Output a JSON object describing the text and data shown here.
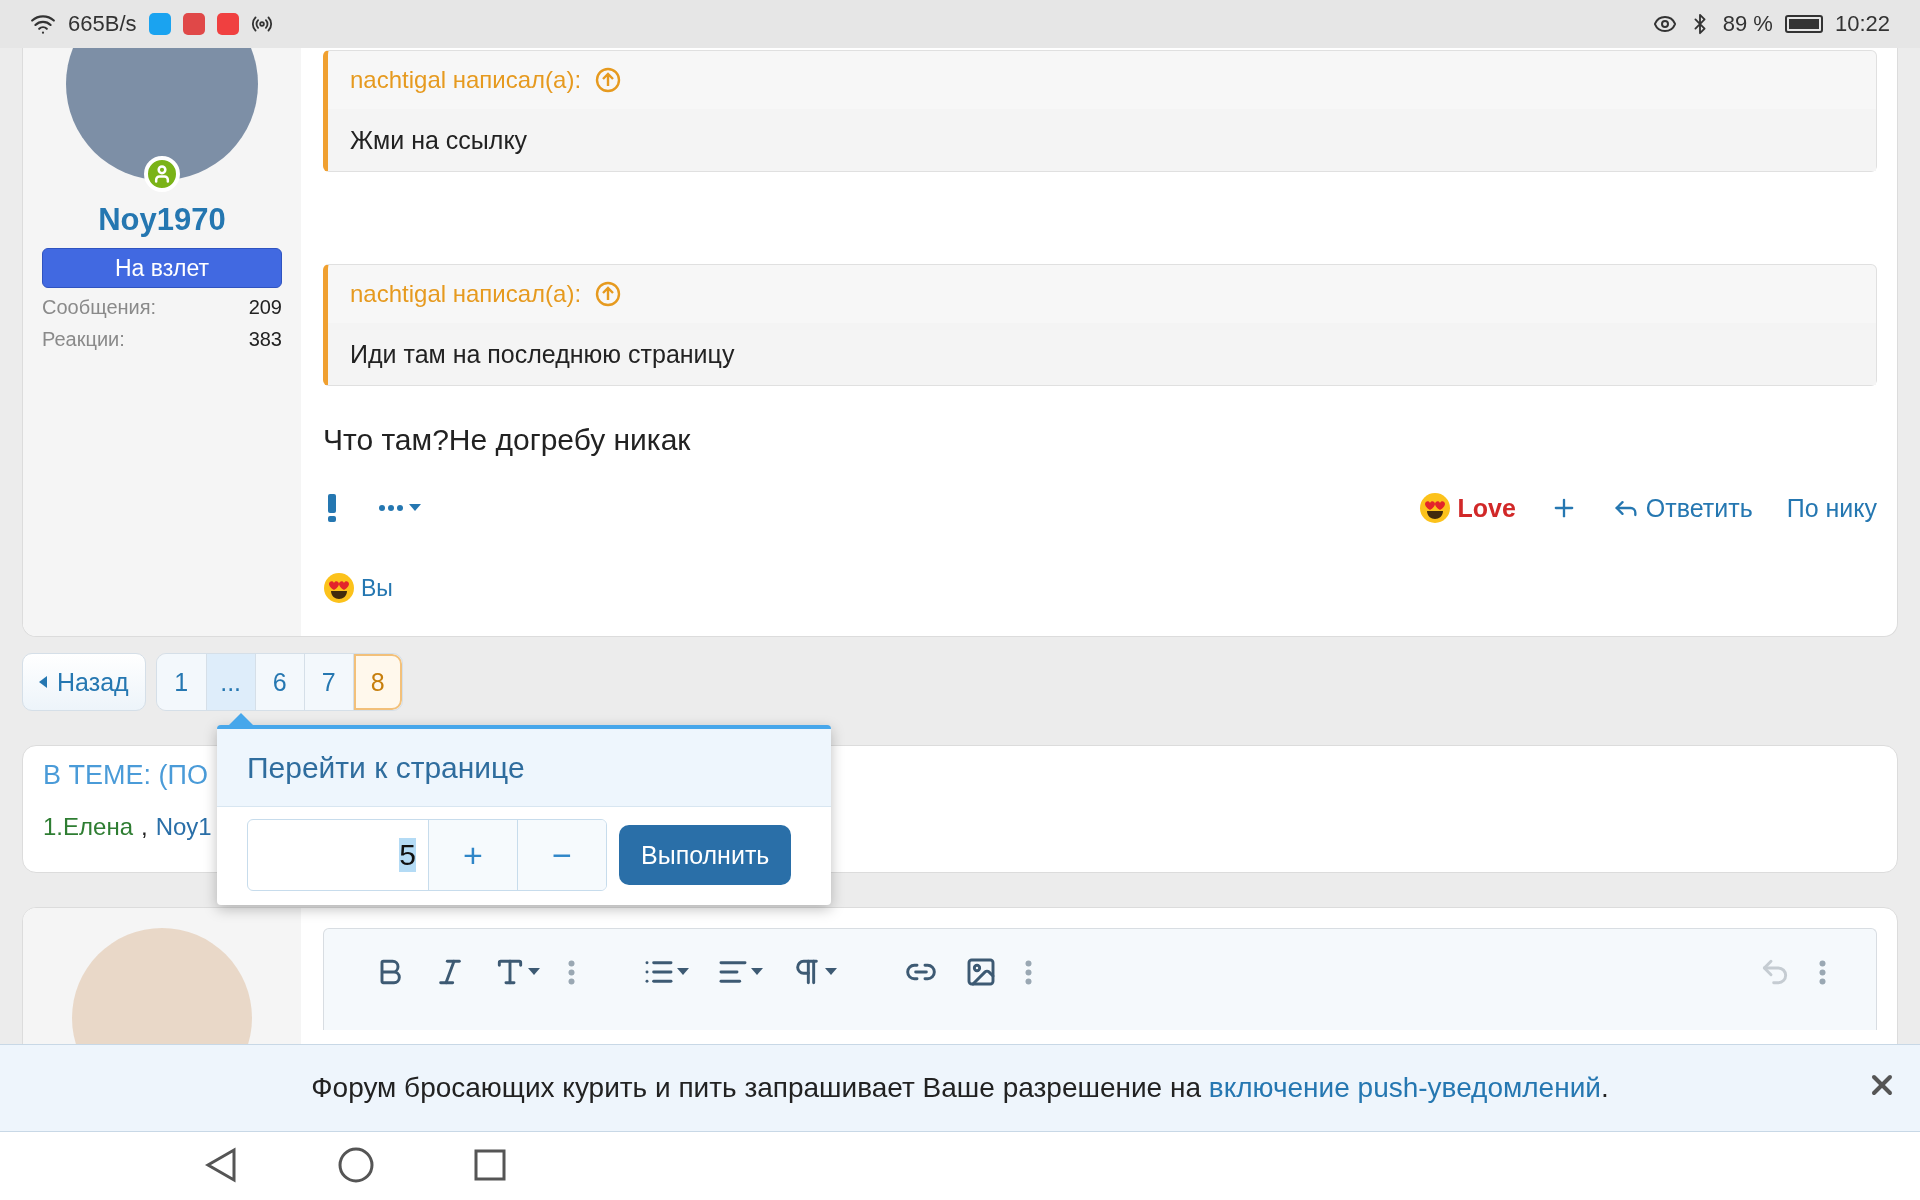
{
  "status_bar": {
    "network_speed": "665B/s",
    "battery": "89 %",
    "time": "10:22"
  },
  "post": {
    "author": {
      "name": "Noy1970",
      "title": "На взлет",
      "online": true,
      "stats": [
        {
          "label": "Сообщения:",
          "value": "209"
        },
        {
          "label": "Реакции:",
          "value": "383"
        }
      ]
    },
    "quotes": [
      {
        "attribution": "nachtigal написал(а):",
        "text": "Жми на ссылку"
      },
      {
        "attribution": "nachtigal написал(а):",
        "text": "Иди там на последнюю страницу"
      }
    ],
    "message": "Что там?Не догребу никак",
    "actions": {
      "reaction": "Love",
      "reply": "Ответить",
      "by_nick": "По нику"
    },
    "reactions_summary": "Вы"
  },
  "pagination": {
    "back": "Назад",
    "pages": [
      {
        "label": "1",
        "selected": false,
        "expanded": false
      },
      {
        "label": "...",
        "selected": false,
        "expanded": true
      },
      {
        "label": "6",
        "selected": false,
        "expanded": false
      },
      {
        "label": "7",
        "selected": false,
        "expanded": false
      },
      {
        "label": "8",
        "selected": true,
        "expanded": false
      }
    ]
  },
  "page_jump": {
    "title": "Перейти к странице",
    "value": "5",
    "increment": "+",
    "decrement": "−",
    "submit": "Выполнить"
  },
  "topic": {
    "heading": "В ТЕМЕ: (ПО",
    "separator": ",",
    "participants": [
      {
        "name": "1.Елена",
        "color": "#2e7d32"
      },
      {
        "name": "Noy1",
        "color": "#2a6fa8"
      }
    ]
  },
  "push_banner": {
    "text": "Форум бросающих курить и пить запрашивает Ваше разрешение на ",
    "link": "включение push-уведомлений",
    "end": "."
  }
}
